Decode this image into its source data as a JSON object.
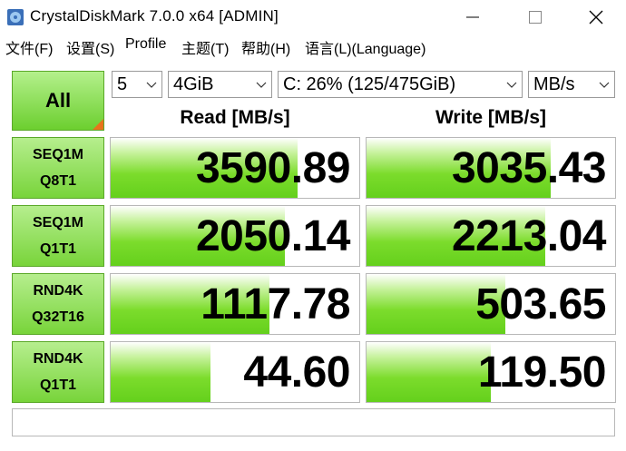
{
  "window": {
    "title": "CrystalDiskMark 7.0.0 x64 [ADMIN]",
    "icons": {
      "app": "crystaldiskmark-icon",
      "minimize": "minimize-icon",
      "maximize": "maximize-icon",
      "close": "close-icon"
    }
  },
  "menu": [
    {
      "label": "文件(F)"
    },
    {
      "label": "设置(S)"
    },
    {
      "label": "Profile"
    },
    {
      "label": "主题(T)"
    },
    {
      "label": "帮助(H)"
    },
    {
      "label": "语言(L)(Language)"
    }
  ],
  "controls": {
    "all_label": "All",
    "count": "5",
    "size": "4GiB",
    "drive": "C: 26% (125/475GiB)",
    "unit": "MB/s"
  },
  "headers": {
    "read": "Read [MB/s]",
    "write": "Write [MB/s]"
  },
  "tests": [
    {
      "line1": "SEQ1M",
      "line2": "Q8T1",
      "read": "3590.89",
      "write": "3035.43",
      "read_fill": 0.75,
      "write_fill": 0.74
    },
    {
      "line1": "SEQ1M",
      "line2": "Q1T1",
      "read": "2050.14",
      "write": "2213.04",
      "read_fill": 0.7,
      "write_fill": 0.72
    },
    {
      "line1": "RND4K",
      "line2": "Q32T16",
      "read": "1117.78",
      "write": "503.65",
      "read_fill": 0.64,
      "write_fill": 0.56
    },
    {
      "line1": "RND4K",
      "line2": "Q1T1",
      "read": "44.60",
      "write": "119.50",
      "read_fill": 0.4,
      "write_fill": 0.5
    }
  ],
  "status_text": "",
  "colors": {
    "bar_green": "#64d01c",
    "label_green": "#78d43a",
    "accent_orange": "#e8731c"
  }
}
